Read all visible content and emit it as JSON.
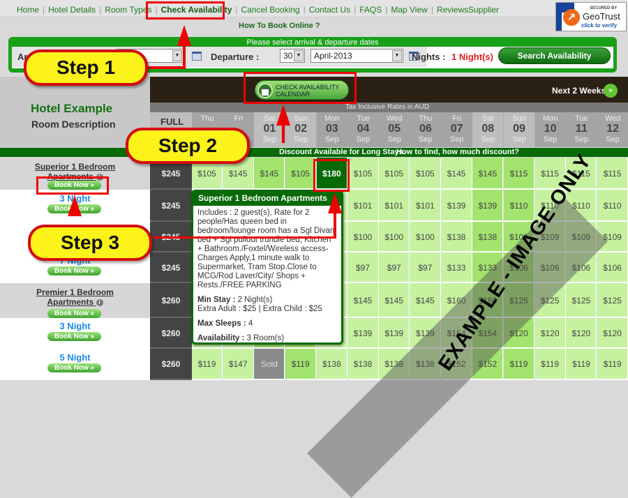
{
  "nav": {
    "items": [
      "Home",
      "Hotel Details",
      "Room Types",
      "Check Availability",
      "Cancel Booking",
      "Contact Us",
      "FAQS",
      "Map View",
      "Reviews"
    ],
    "active": "Check Availability",
    "supplier": "Supplier"
  },
  "geotrust": {
    "secured_by": "SECURED BY",
    "brand": "GeoTrust",
    "click": "click to verify"
  },
  "how_to_book": "How To Book Online ?",
  "search": {
    "hint": "Please select arrival & departure dates",
    "arrival_label": "Arrival :",
    "departure_label": "Departure :",
    "departure_day": "30",
    "departure_month": "April-2013",
    "nights_label": "Nights :",
    "nights_value": "1 Night(s)",
    "search_button": "Search Availability"
  },
  "hotel": {
    "name": "Hotel Example",
    "room_description": "Room Description"
  },
  "calendar": {
    "check_button_line1": "CHECK AVAILABILITY",
    "check_button_line2": "CALENDAR",
    "next_weeks": "Next 2 Weeks",
    "tax_note": "Tax Inclusive Rates in AUD",
    "full_label": "FULL",
    "days": [
      {
        "dow": "Thu",
        "day": "",
        "mon": ""
      },
      {
        "dow": "Fri",
        "day": "",
        "mon": ""
      },
      {
        "dow": "Sat",
        "day": "01",
        "mon": "Sep"
      },
      {
        "dow": "Sun",
        "day": "02",
        "mon": "Sep"
      },
      {
        "dow": "Mon",
        "day": "03",
        "mon": "Sep"
      },
      {
        "dow": "Tue",
        "day": "04",
        "mon": "Sep"
      },
      {
        "dow": "Wed",
        "day": "05",
        "mon": "Sep"
      },
      {
        "dow": "Thu",
        "day": "06",
        "mon": "Sep"
      },
      {
        "dow": "Fri",
        "day": "07",
        "mon": "Sep"
      },
      {
        "dow": "Sat",
        "day": "08",
        "mon": "Sep"
      },
      {
        "dow": "Sun",
        "day": "09",
        "mon": "Sep"
      },
      {
        "dow": "Mon",
        "day": "10",
        "mon": "Sep"
      },
      {
        "dow": "Tue",
        "day": "11",
        "mon": "Sep"
      },
      {
        "dow": "Wed",
        "day": "12",
        "mon": "Sep"
      }
    ],
    "discount_text": "Discount Available for Long Stays.",
    "discount_link": "How to find, how much discount?"
  },
  "rooms": [
    {
      "kind": "header",
      "name_line1": "Superior 1 Bedroom",
      "name_line2": "Apartments",
      "book": "Book Now",
      "full": "$245",
      "rates": [
        "$105",
        "$145",
        "$145",
        "$105",
        "$180",
        "$105",
        "$105",
        "$105",
        "$145",
        "$145",
        "$115",
        "$115",
        "$115",
        "$115"
      ]
    },
    {
      "kind": "sub",
      "label": "3 Night",
      "book": "Book Now",
      "full": "$245",
      "rates": [
        "",
        "",
        "",
        "",
        "",
        "$101",
        "$101",
        "$101",
        "$139",
        "$139",
        "$110",
        "$110",
        "$110",
        "$110"
      ]
    },
    {
      "kind": "sub",
      "label": "",
      "book": "",
      "full": "$245",
      "rates": [
        "",
        "",
        "",
        "",
        "",
        "$100",
        "$100",
        "$100",
        "$138",
        "$138",
        "$109",
        "$109",
        "$109",
        "$109"
      ]
    },
    {
      "kind": "sub",
      "label": "7 Night",
      "book": "Book Now",
      "full": "$245",
      "rates": [
        "",
        "",
        "",
        "",
        "",
        "$97",
        "$97",
        "$97",
        "$133",
        "$133",
        "$106",
        "$106",
        "$106",
        "$106"
      ]
    },
    {
      "kind": "header",
      "name_line1": "Premier 1 Bedroom",
      "name_line2": "Apartments",
      "book": "Book Now",
      "full": "$260",
      "rates": [
        "",
        "",
        "",
        "",
        "",
        "$145",
        "$145",
        "$145",
        "$160",
        "$160",
        "$125",
        "$125",
        "$125",
        "$125"
      ]
    },
    {
      "kind": "sub",
      "label": "3 Night",
      "book": "Book Now",
      "full": "$260",
      "rates": [
        "",
        "",
        "",
        "",
        "",
        "$139",
        "$139",
        "$139",
        "$154",
        "$154",
        "$120",
        "$120",
        "$120",
        "$120"
      ]
    },
    {
      "kind": "sub",
      "label": "5 Night",
      "book": "Book Now",
      "full": "$260",
      "rates": [
        "$119",
        "$147",
        "Sold",
        "$119",
        "$138",
        "$138",
        "$138",
        "$138",
        "$152",
        "$152",
        "$119",
        "$119",
        "$119",
        "$119"
      ]
    }
  ],
  "tooltip": {
    "title": "Superior 1 Bedroom Apartments",
    "includes": "Includes : 2 guest(s), Rate for 2 people/Has queen bed in bedroom/lounge room has a Sgl Divan bed + Sgl pullout trundle bed, Kitchen + Bathroom./Foxtel/Wireless access-Charges Apply,1 minute walk to Supermarket, Tram Stop.Close to MCG/Rod Laver/City/ Shops + Rests./FREE PARKING",
    "min_stay_label": "Min Stay :",
    "min_stay": "2 Night(s)",
    "extras": "Extra Adult : $25 | Extra Child : $25",
    "max_sleeps_label": "Max Sleeps :",
    "max_sleeps": "4",
    "availability_label": "Availability :",
    "availability": "3 Room(s)"
  },
  "annotations": {
    "step1": "Step 1",
    "step2": "Step 2",
    "step3": "Step 3",
    "watermark": "EXAMPLE - IMAGE ONLY"
  },
  "colors": {
    "brand_green": "#076a07",
    "accent_red": "#e00000",
    "step_yellow": "#fbf31a",
    "rate_light": "#c6f2a0",
    "rate_weekend": "#a2e46e"
  }
}
